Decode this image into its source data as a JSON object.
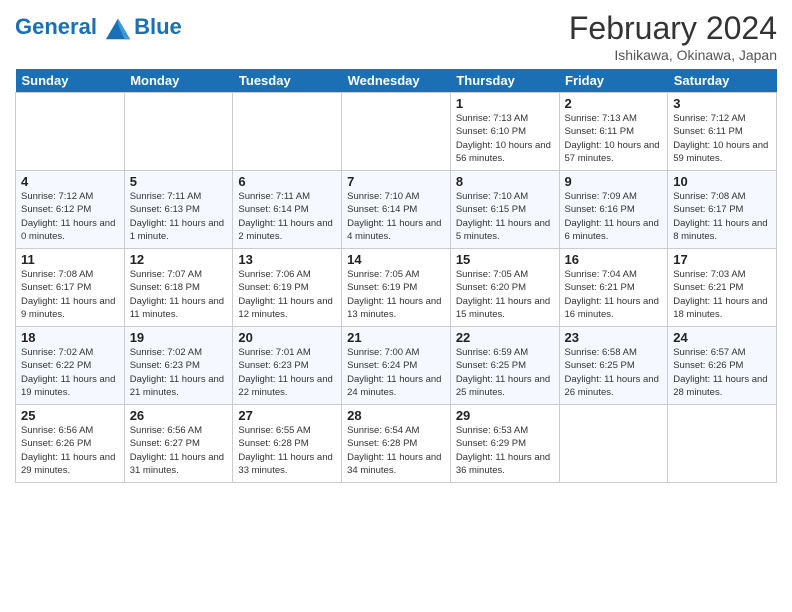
{
  "header": {
    "logo_line1": "General",
    "logo_line2": "Blue",
    "month_year": "February 2024",
    "location": "Ishikawa, Okinawa, Japan"
  },
  "days": [
    "Sunday",
    "Monday",
    "Tuesday",
    "Wednesday",
    "Thursday",
    "Friday",
    "Saturday"
  ],
  "weeks": [
    [
      {
        "num": "",
        "info": ""
      },
      {
        "num": "",
        "info": ""
      },
      {
        "num": "",
        "info": ""
      },
      {
        "num": "",
        "info": ""
      },
      {
        "num": "1",
        "info": "Sunrise: 7:13 AM\nSunset: 6:10 PM\nDaylight: 10 hours and 56 minutes."
      },
      {
        "num": "2",
        "info": "Sunrise: 7:13 AM\nSunset: 6:11 PM\nDaylight: 10 hours and 57 minutes."
      },
      {
        "num": "3",
        "info": "Sunrise: 7:12 AM\nSunset: 6:11 PM\nDaylight: 10 hours and 59 minutes."
      }
    ],
    [
      {
        "num": "4",
        "info": "Sunrise: 7:12 AM\nSunset: 6:12 PM\nDaylight: 11 hours and 0 minutes."
      },
      {
        "num": "5",
        "info": "Sunrise: 7:11 AM\nSunset: 6:13 PM\nDaylight: 11 hours and 1 minute."
      },
      {
        "num": "6",
        "info": "Sunrise: 7:11 AM\nSunset: 6:14 PM\nDaylight: 11 hours and 2 minutes."
      },
      {
        "num": "7",
        "info": "Sunrise: 7:10 AM\nSunset: 6:14 PM\nDaylight: 11 hours and 4 minutes."
      },
      {
        "num": "8",
        "info": "Sunrise: 7:10 AM\nSunset: 6:15 PM\nDaylight: 11 hours and 5 minutes."
      },
      {
        "num": "9",
        "info": "Sunrise: 7:09 AM\nSunset: 6:16 PM\nDaylight: 11 hours and 6 minutes."
      },
      {
        "num": "10",
        "info": "Sunrise: 7:08 AM\nSunset: 6:17 PM\nDaylight: 11 hours and 8 minutes."
      }
    ],
    [
      {
        "num": "11",
        "info": "Sunrise: 7:08 AM\nSunset: 6:17 PM\nDaylight: 11 hours and 9 minutes."
      },
      {
        "num": "12",
        "info": "Sunrise: 7:07 AM\nSunset: 6:18 PM\nDaylight: 11 hours and 11 minutes."
      },
      {
        "num": "13",
        "info": "Sunrise: 7:06 AM\nSunset: 6:19 PM\nDaylight: 11 hours and 12 minutes."
      },
      {
        "num": "14",
        "info": "Sunrise: 7:05 AM\nSunset: 6:19 PM\nDaylight: 11 hours and 13 minutes."
      },
      {
        "num": "15",
        "info": "Sunrise: 7:05 AM\nSunset: 6:20 PM\nDaylight: 11 hours and 15 minutes."
      },
      {
        "num": "16",
        "info": "Sunrise: 7:04 AM\nSunset: 6:21 PM\nDaylight: 11 hours and 16 minutes."
      },
      {
        "num": "17",
        "info": "Sunrise: 7:03 AM\nSunset: 6:21 PM\nDaylight: 11 hours and 18 minutes."
      }
    ],
    [
      {
        "num": "18",
        "info": "Sunrise: 7:02 AM\nSunset: 6:22 PM\nDaylight: 11 hours and 19 minutes."
      },
      {
        "num": "19",
        "info": "Sunrise: 7:02 AM\nSunset: 6:23 PM\nDaylight: 11 hours and 21 minutes."
      },
      {
        "num": "20",
        "info": "Sunrise: 7:01 AM\nSunset: 6:23 PM\nDaylight: 11 hours and 22 minutes."
      },
      {
        "num": "21",
        "info": "Sunrise: 7:00 AM\nSunset: 6:24 PM\nDaylight: 11 hours and 24 minutes."
      },
      {
        "num": "22",
        "info": "Sunrise: 6:59 AM\nSunset: 6:25 PM\nDaylight: 11 hours and 25 minutes."
      },
      {
        "num": "23",
        "info": "Sunrise: 6:58 AM\nSunset: 6:25 PM\nDaylight: 11 hours and 26 minutes."
      },
      {
        "num": "24",
        "info": "Sunrise: 6:57 AM\nSunset: 6:26 PM\nDaylight: 11 hours and 28 minutes."
      }
    ],
    [
      {
        "num": "25",
        "info": "Sunrise: 6:56 AM\nSunset: 6:26 PM\nDaylight: 11 hours and 29 minutes."
      },
      {
        "num": "26",
        "info": "Sunrise: 6:56 AM\nSunset: 6:27 PM\nDaylight: 11 hours and 31 minutes."
      },
      {
        "num": "27",
        "info": "Sunrise: 6:55 AM\nSunset: 6:28 PM\nDaylight: 11 hours and 33 minutes."
      },
      {
        "num": "28",
        "info": "Sunrise: 6:54 AM\nSunset: 6:28 PM\nDaylight: 11 hours and 34 minutes."
      },
      {
        "num": "29",
        "info": "Sunrise: 6:53 AM\nSunset: 6:29 PM\nDaylight: 11 hours and 36 minutes."
      },
      {
        "num": "",
        "info": ""
      },
      {
        "num": "",
        "info": ""
      }
    ]
  ]
}
